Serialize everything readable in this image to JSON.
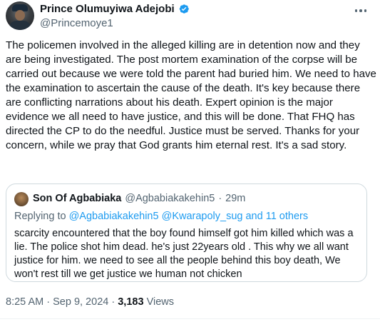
{
  "author": {
    "display_name": "Prince Olumuyiwa Adejobi",
    "handle": "@Princemoye1"
  },
  "tweet": {
    "text": "The policemen involved in the alleged killing are in detention now and they are being investigated. The post mortem examination of the corpse will be carried out because we were told the parent had buried him. We need to have the examination to ascertain the cause of the death. It's key because there are conflicting narrations about his death. Expert opinion is the major evidence we all need to have justice, and this will be done. That FHQ has directed the CP to do the needful. Justice must be served. Thanks for your concern, while we pray that God grants him eternal rest. It's a sad story."
  },
  "quote": {
    "display_name": "Son Of Agbabiaka",
    "handle": "@Agbabiakakehin5",
    "separator": "·",
    "time": "29m",
    "replying_prefix": "Replying to ",
    "replying_handle_1": "@Agbabiakakehin5",
    "replying_handle_2": "@Kwarapoly_sug",
    "replying_suffix": " and 11 others",
    "text": "scarcity encountered that the boy found himself got him killed which was a lie. The police shot him dead. he's just 22years old . This why we all want justice for him. we need to see all the people behind this boy death, We won't rest till we get justice we human not chicken"
  },
  "meta": {
    "time": "8:25 AM",
    "separator": "·",
    "date": "Sep 9, 2024",
    "views_count": "3,183",
    "views_label": "Views"
  },
  "icons": {
    "verified": "verified-badge-icon",
    "more": "more-options-icon"
  },
  "colors": {
    "verified": "#1d9bf0",
    "link": "#1d9bf0",
    "secondary_text": "#536471"
  }
}
